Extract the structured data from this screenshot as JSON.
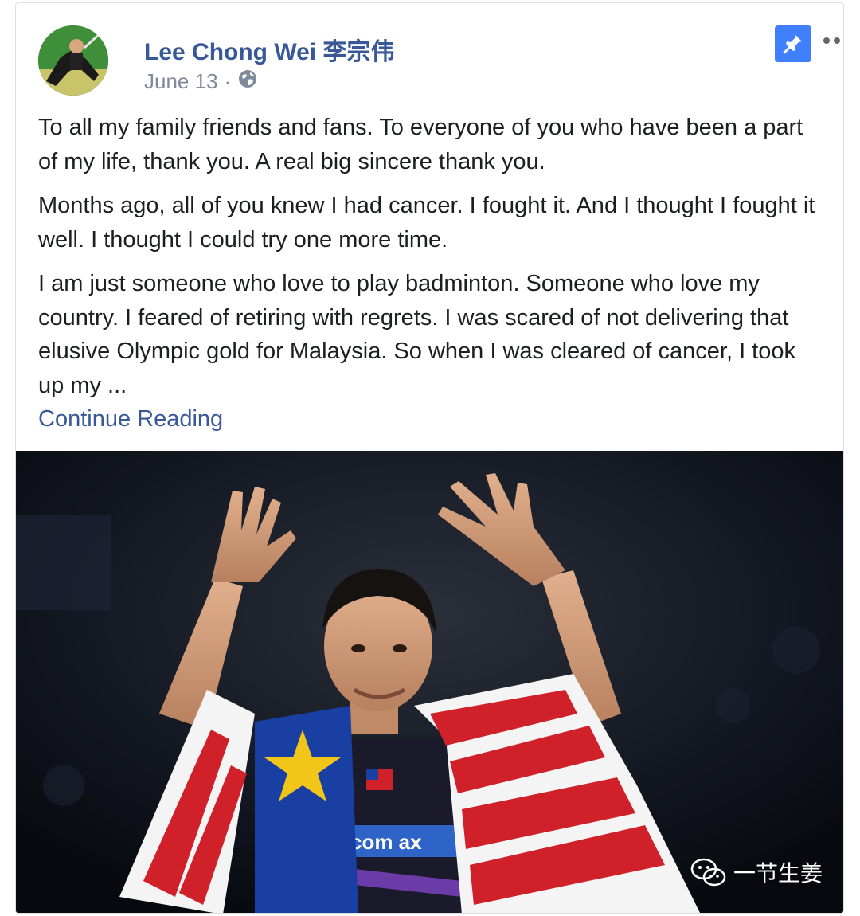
{
  "post": {
    "author": "Lee Chong Wei 李宗伟",
    "date": "June 13",
    "separator": "·",
    "privacy_icon": "globe-icon",
    "paragraphs": [
      "To all my family friends and fans. To everyone of you who have been a part of my life, thank you. A real big sincere thank you.",
      "Months ago, all of you knew I had cancer. I fought it. And I thought I fought it well. I thought I could try one more time.",
      "I am just someone who love to play badminton. Someone who love my country. I feared of retiring with regrets. I was scared of not delivering that elusive Olympic gold for Malaysia. So when I was cleared of cancer, I took up my ..."
    ],
    "continue_label": "Continue Reading",
    "pin_icon": "pushpin-icon",
    "more_icon": "more-options-icon"
  },
  "photo": {
    "jersey_text": "com ax",
    "description_icon": "athlete-photo"
  },
  "watermark": {
    "text": "一节生姜",
    "icon": "wechat-icon"
  },
  "colors": {
    "link": "#385898",
    "meta": "#7f8a9a",
    "pin_bg": "#4080ff",
    "text": "#1c1e21",
    "border": "#dddfe2"
  }
}
